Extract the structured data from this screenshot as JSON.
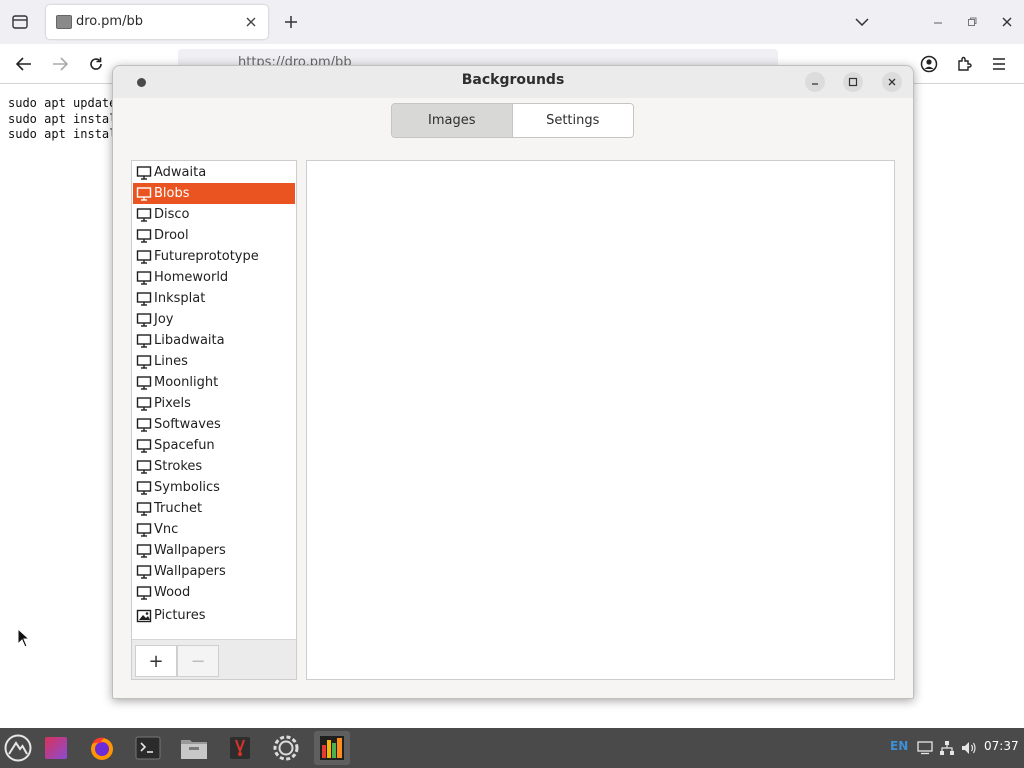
{
  "browser": {
    "tab": {
      "title": "dro.pm/bb"
    },
    "url": "https://dro.pm/bb",
    "page_lines": [
      "sudo apt update",
      "sudo apt instal",
      "sudo apt instal"
    ]
  },
  "dialog": {
    "title": "Backgrounds",
    "tabs": [
      {
        "label": "Images",
        "active": true
      },
      {
        "label": "Settings",
        "active": false
      }
    ],
    "list_items": [
      {
        "label": "Adwaita",
        "icon": "monitor-icon",
        "selected": false
      },
      {
        "label": "Blobs",
        "icon": "monitor-icon",
        "selected": true
      },
      {
        "label": "Disco",
        "icon": "monitor-icon",
        "selected": false
      },
      {
        "label": "Drool",
        "icon": "monitor-icon",
        "selected": false
      },
      {
        "label": "Futureprototype",
        "icon": "monitor-icon",
        "selected": false
      },
      {
        "label": "Homeworld",
        "icon": "monitor-icon",
        "selected": false
      },
      {
        "label": "Inksplat",
        "icon": "monitor-icon",
        "selected": false
      },
      {
        "label": "Joy",
        "icon": "monitor-icon",
        "selected": false
      },
      {
        "label": "Libadwaita",
        "icon": "monitor-icon",
        "selected": false
      },
      {
        "label": "Lines",
        "icon": "monitor-icon",
        "selected": false
      },
      {
        "label": "Moonlight",
        "icon": "monitor-icon",
        "selected": false
      },
      {
        "label": "Pixels",
        "icon": "monitor-icon",
        "selected": false
      },
      {
        "label": "Softwaves",
        "icon": "monitor-icon",
        "selected": false
      },
      {
        "label": "Spacefun",
        "icon": "monitor-icon",
        "selected": false
      },
      {
        "label": "Strokes",
        "icon": "monitor-icon",
        "selected": false
      },
      {
        "label": "Symbolics",
        "icon": "monitor-icon",
        "selected": false
      },
      {
        "label": "Truchet",
        "icon": "monitor-icon",
        "selected": false
      },
      {
        "label": "Vnc",
        "icon": "monitor-icon",
        "selected": false
      },
      {
        "label": "Wallpapers",
        "icon": "monitor-icon",
        "selected": false
      },
      {
        "label": "Wallpapers",
        "icon": "monitor-icon",
        "selected": false
      },
      {
        "label": "Wood",
        "icon": "monitor-icon",
        "selected": false
      },
      {
        "label": "Pictures",
        "icon": "image-icon",
        "selected": false
      }
    ],
    "toolbar": {
      "add_label": "+",
      "remove_label": "−"
    }
  },
  "taskbar": {
    "apps": [
      {
        "name": "app-menu-icon",
        "running": false
      },
      {
        "name": "color-app-icon",
        "running": false
      },
      {
        "name": "firefox-icon",
        "running": false
      },
      {
        "name": "terminal-icon",
        "running": false
      },
      {
        "name": "files-icon",
        "running": false
      },
      {
        "name": "tweaks-icon",
        "running": false
      },
      {
        "name": "settings-icon",
        "running": false
      },
      {
        "name": "backgrounds-icon",
        "running": true
      }
    ],
    "language": "EN",
    "clock": "07:37"
  },
  "colors": {
    "accent": "#e95420",
    "taskbar": "#4a4a4a",
    "lang": "#3d8fd6"
  }
}
